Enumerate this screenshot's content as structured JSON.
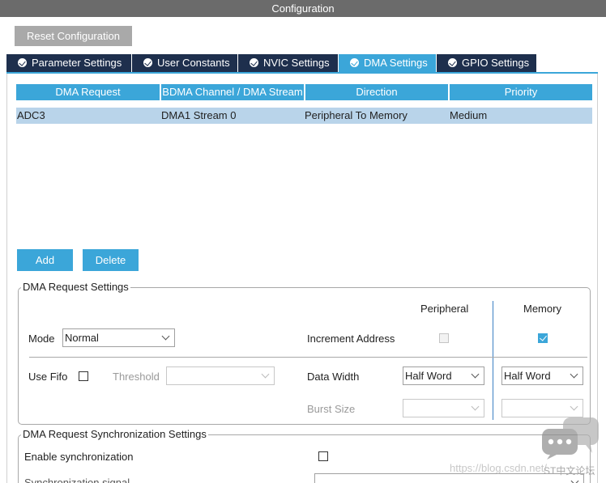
{
  "window": {
    "title": "Configuration"
  },
  "toolbar": {
    "reset_label": "Reset Configuration"
  },
  "tabs": [
    {
      "label": "Parameter Settings",
      "active": false
    },
    {
      "label": "User Constants",
      "active": false
    },
    {
      "label": "NVIC Settings",
      "active": false
    },
    {
      "label": "DMA Settings",
      "active": true
    },
    {
      "label": "GPIO Settings",
      "active": false
    }
  ],
  "table": {
    "columns": [
      "DMA Request",
      "BDMA Channel / DMA Stream",
      "Direction",
      "Priority"
    ],
    "rows": [
      [
        "ADC3",
        "DMA1 Stream 0",
        "Peripheral To Memory",
        "Medium"
      ]
    ]
  },
  "actions": {
    "add_label": "Add",
    "delete_label": "Delete"
  },
  "request_settings": {
    "title": "DMA Request Settings",
    "peripheral_header": "Peripheral",
    "memory_header": "Memory",
    "mode_label": "Mode",
    "mode_value": "Normal",
    "increment_label": "Increment Address",
    "peripheral_increment": false,
    "memory_increment": true,
    "fifo_label": "Use Fifo",
    "fifo_checked": false,
    "threshold_label": "Threshold",
    "threshold_value": "",
    "data_width_label": "Data Width",
    "peripheral_data_width": "Half Word",
    "memory_data_width": "Half Word",
    "burst_label": "Burst Size",
    "peripheral_burst": "",
    "memory_burst": ""
  },
  "sync_settings": {
    "title": "DMA Request Synchronization Settings",
    "enable_label": "Enable synchronization",
    "enable_checked": false,
    "signal_label": "Synchronization signal"
  },
  "watermark": {
    "url_text": "https://blog.csdn.net/",
    "brand_text": "ST中文论坛"
  },
  "colors": {
    "accent": "#3ba6d9",
    "tab_dark": "#1e2f4d",
    "titlebar": "#6b6b6b",
    "row_selected": "#b9d4ea"
  }
}
